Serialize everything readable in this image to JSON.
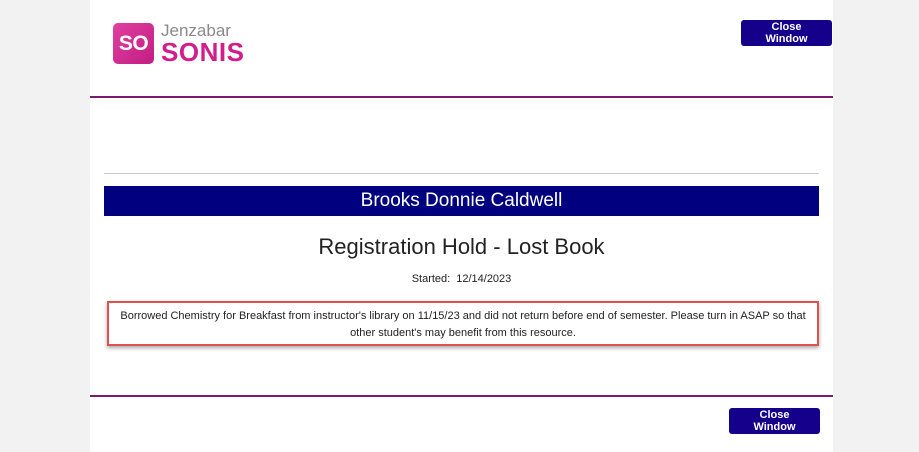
{
  "logo": {
    "mark": "SO",
    "brand": "Jenzabar",
    "product": "SONIS"
  },
  "header": {
    "close_label": "Close Window"
  },
  "footer": {
    "close_label": "Close Window"
  },
  "student": {
    "name": "Brooks Donnie Caldwell"
  },
  "hold": {
    "title": "Registration Hold - Lost Book",
    "started_label": "Started:",
    "started_date": "12/14/2023",
    "note": "Borrowed Chemistry for Breakfast from instructor's library on 11/15/23 and did not return before end of semester. Please turn in ASAP so that other student's may benefit from this resource."
  },
  "colors": {
    "brand_pink": "#d11e8c",
    "button_navy": "#15008c",
    "name_bar": "#01017f",
    "rule_purple": "#7a1a6e",
    "highlight_red": "#e05050"
  }
}
